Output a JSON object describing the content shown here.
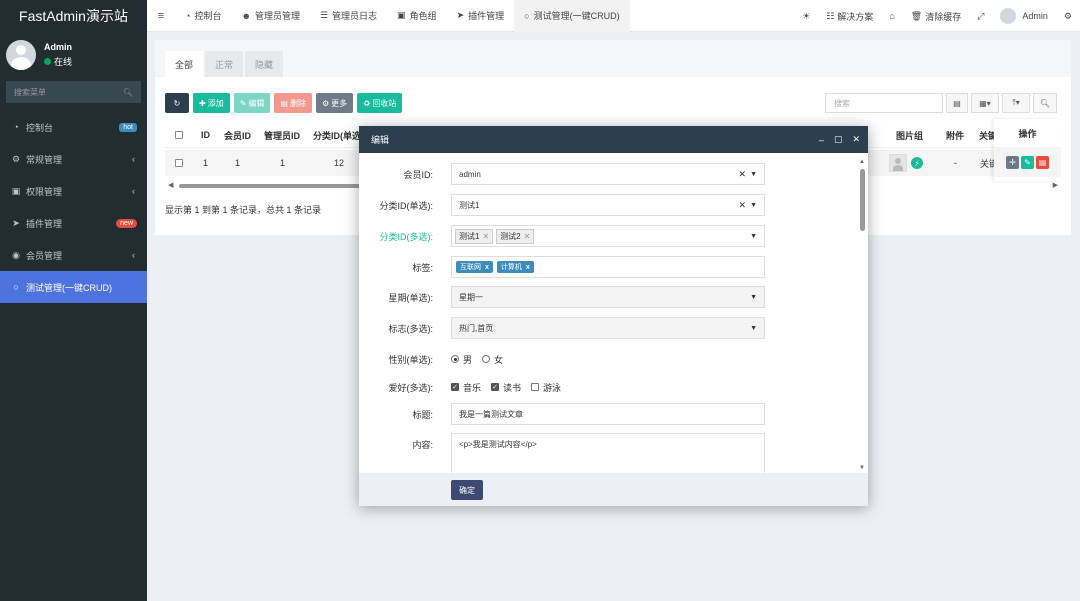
{
  "brand": "FastAdmin演示站",
  "user": {
    "name": "Admin",
    "status": "在线"
  },
  "sidebar": {
    "search_placeholder": "搜索菜单",
    "items": [
      {
        "label": "控制台",
        "icon": "dashboard-icon",
        "badge": "hot"
      },
      {
        "label": "常规管理",
        "icon": "cogs-icon"
      },
      {
        "label": "权限管理",
        "icon": "group-icon"
      },
      {
        "label": "插件管理",
        "icon": "rocket-icon",
        "badge": "new"
      },
      {
        "label": "会员管理",
        "icon": "user-circle-icon"
      },
      {
        "label": "测试管理(一键CRUD)",
        "icon": "circle-icon"
      }
    ]
  },
  "topnav": {
    "tabs": [
      "控制台",
      "管理员管理",
      "管理员日志",
      "角色组",
      "插件管理",
      "测试管理(一键CRUD)"
    ],
    "right": {
      "solutions": "解决方案",
      "clear_cache": "清除缓存",
      "user": "Admin"
    }
  },
  "panel": {
    "tabs": [
      "全部",
      "正常",
      "隐藏"
    ],
    "toolbar": {
      "add": "添加",
      "edit": "编辑",
      "delete": "删除",
      "more": "更多",
      "recycle": "回收站"
    },
    "search_placeholder": "搜索",
    "columns": [
      "ID",
      "会员ID",
      "管理员ID",
      "分类ID(单选",
      "图片组",
      "附件",
      "关键",
      "操作"
    ],
    "row": {
      "id": "1",
      "member_id": "1",
      "admin_id": "1",
      "category_id": "12",
      "attachment": "-",
      "keyword": "关键"
    },
    "records": "显示第 1 到第 1 条记录，总共 1 条记录"
  },
  "dialog": {
    "title": "编辑",
    "fields": {
      "member_label": "会员ID:",
      "member_value": "admin",
      "cat_single_label": "分类ID(单选):",
      "cat_single_value": "测试1",
      "cat_multi_label": "分类ID(多选):",
      "cat_multi_chips": [
        "测试1",
        "测试2"
      ],
      "tags_label": "标签:",
      "tags": [
        "互联网",
        "计算机"
      ],
      "week_label": "星期(单选):",
      "week_value": "星期一",
      "flag_label": "标志(多选):",
      "flag_value": "热门,首页",
      "gender_label": "性别(单选):",
      "gender_options": [
        "男",
        "女"
      ],
      "hobby_label": "爱好(多选):",
      "hobby_options": [
        "音乐",
        "读书",
        "游泳"
      ],
      "title_label": "标题:",
      "title_value": "我是一篇测试文章",
      "content_label": "内容:",
      "content_value": "<p>我是测试内容</p>"
    },
    "ok": "确定"
  }
}
